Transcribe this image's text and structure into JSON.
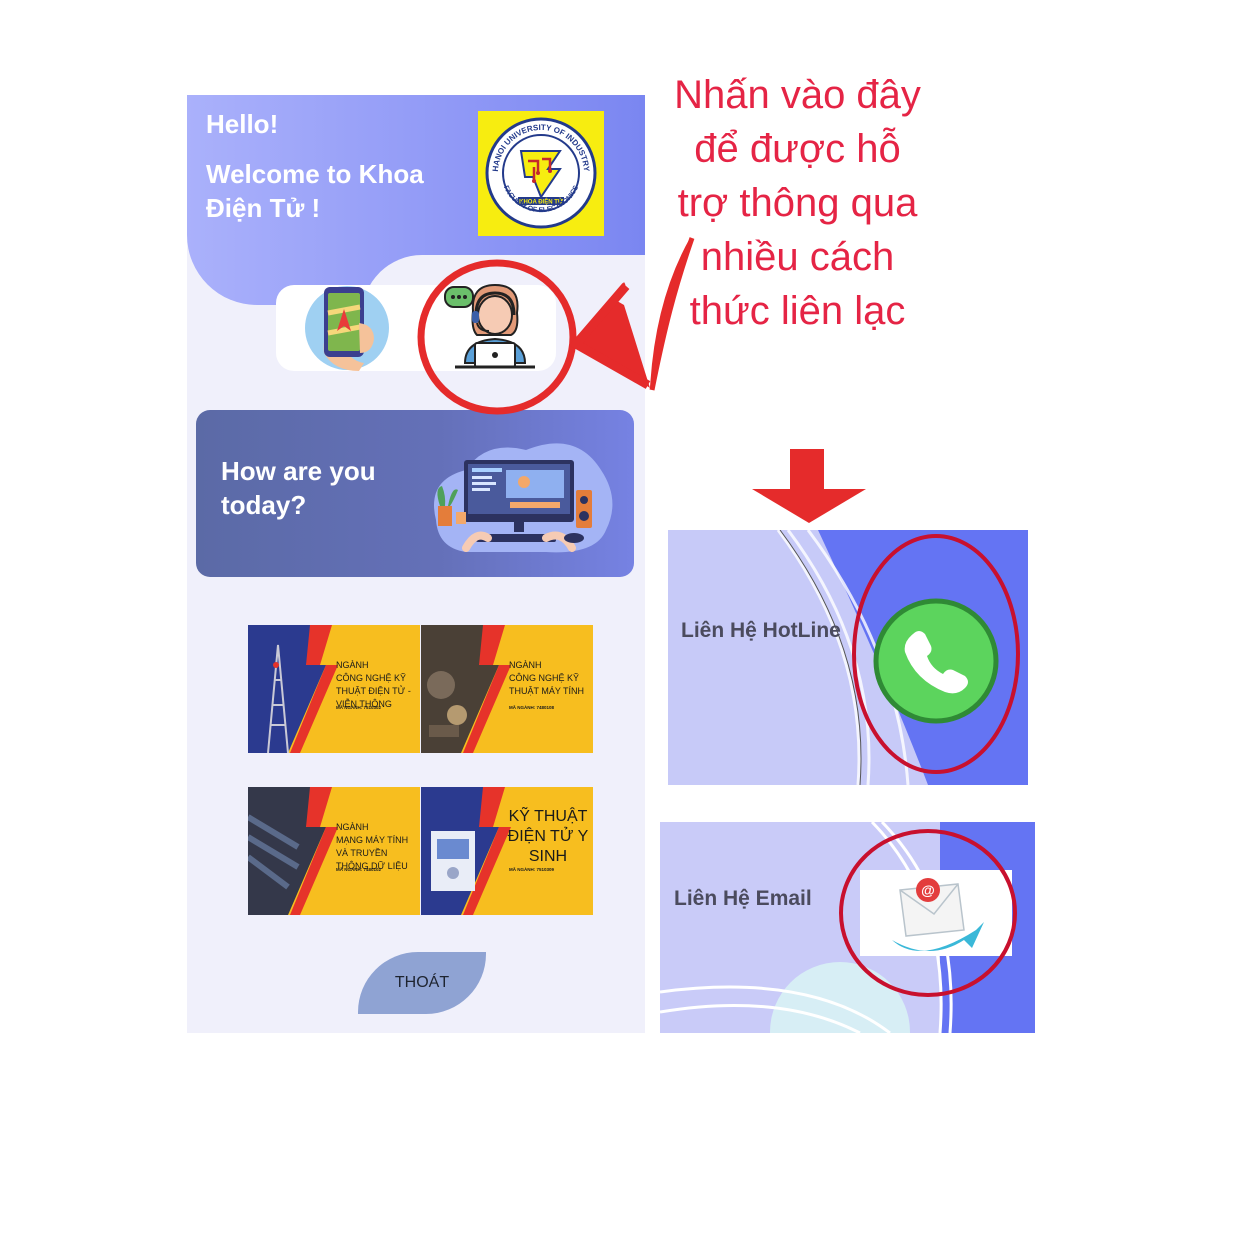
{
  "hero": {
    "greeting": "Hello!",
    "welcome": "Welcome to Khoa Điện Tử !",
    "logo": {
      "top_text": "HANOI UNIVERSITY OF INDUSTRY",
      "center_text": "KHOA ĐIỆN TỬ",
      "bottom_text": "FACULTY OF ELECTRONICS"
    }
  },
  "quick_actions": [
    {
      "icon": "map-navigation-phone-icon"
    },
    {
      "icon": "customer-support-icon"
    }
  ],
  "mood_card": {
    "question": "How are you today?",
    "illustration": "workstation-illustration"
  },
  "programs": [
    {
      "heading": "NGÀNH",
      "title": "CÔNG NGHỆ KỸ THUẬT ĐIỆN TỬ - VIỄN THÔNG",
      "code": "MÃ NGÀNH: 7510302"
    },
    {
      "heading": "NGÀNH",
      "title": "CÔNG NGHỆ KỸ THUẬT MÁY TÍNH",
      "code": "MÃ NGÀNH: 7480108"
    },
    {
      "heading": "NGÀNH",
      "title": "MẠNG MÁY TÍNH VÀ TRUYỀN THÔNG DỮ LIỆU",
      "code": "MÃ NGÀNH: 7480102"
    },
    {
      "heading": "",
      "title": "KỸ THUẬT ĐIỆN TỬ Y SINH",
      "code": "MÃ NGÀNH: 7510309"
    }
  ],
  "exit_button": {
    "label": "THOÁT"
  },
  "annotation": {
    "text": "Nhấn vào đây để được hỗ trợ thông qua nhiều cách thức liên lạc"
  },
  "contacts": {
    "hotline": {
      "label": "Liên Hệ HotLine",
      "icon": "phone-icon"
    },
    "email": {
      "label": "Liên Hệ Email",
      "icon": "email-icon"
    }
  },
  "colors": {
    "annotation_red": "#e52445",
    "hero_blue": "#8f98f6",
    "banner_yellow": "#f7be1f",
    "phone_green": "#5cd45d"
  }
}
